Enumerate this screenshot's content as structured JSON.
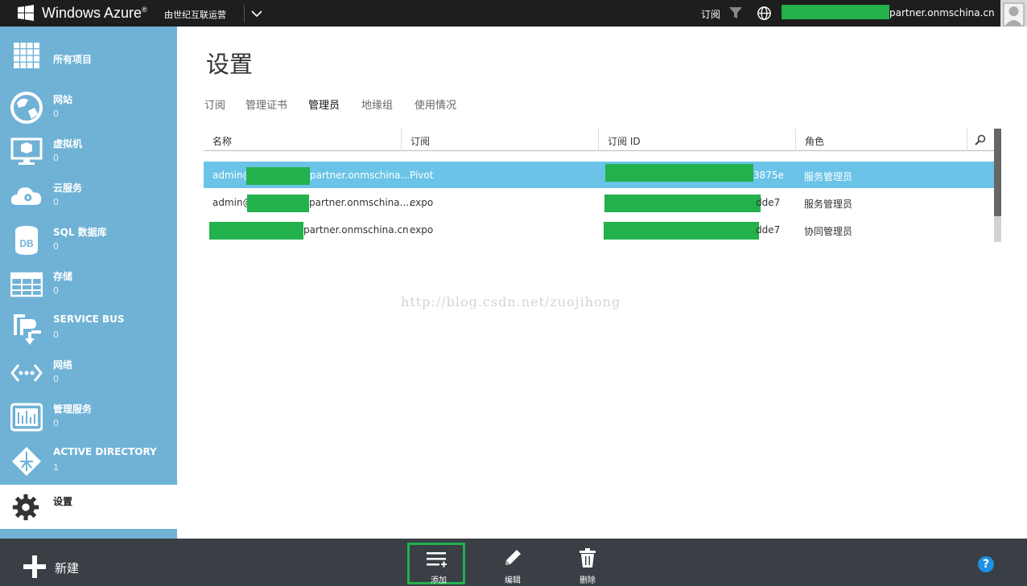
{
  "topbar": {
    "brand": "Windows Azure",
    "brand_mark": "®",
    "operator": "由世纪互联运营",
    "subscriptions_label": "订阅",
    "account_suffix": "partner.onmschina.cn"
  },
  "sidebar": {
    "items": [
      {
        "label": "所有项目",
        "count": "",
        "icon": "grid-icon"
      },
      {
        "label": "网站",
        "count": "0",
        "icon": "website-globe-icon"
      },
      {
        "label": "虚拟机",
        "count": "0",
        "icon": "virtual-machine-icon"
      },
      {
        "label": "云服务",
        "count": "0",
        "icon": "cloud-service-icon"
      },
      {
        "label": "SQL 数据库",
        "count": "0",
        "icon": "database-icon"
      },
      {
        "label": "存储",
        "count": "0",
        "icon": "storage-table-icon"
      },
      {
        "label": "SERVICE BUS",
        "count": "0",
        "icon": "service-bus-icon"
      },
      {
        "label": "网络",
        "count": "0",
        "icon": "network-icon"
      },
      {
        "label": "管理服务",
        "count": "0",
        "icon": "management-services-icon"
      },
      {
        "label": "ACTIVE DIRECTORY",
        "count": "1",
        "icon": "active-directory-icon"
      },
      {
        "label": "设置",
        "count": "",
        "icon": "gear-icon"
      }
    ]
  },
  "main": {
    "title": "设置",
    "tabs": [
      "订阅",
      "管理证书",
      "管理员",
      "地缘组",
      "使用情况"
    ],
    "active_tab": "管理员",
    "columns": [
      "名称",
      "订阅",
      "订阅 ID",
      "角色"
    ],
    "rows": [
      {
        "name_prefix": "admin@",
        "name_suffix": "partner.onmschina....",
        "subscription": "Pivot",
        "id_suffix": "3875e",
        "role": "服务管理员"
      },
      {
        "name_prefix": "admin@",
        "name_suffix": "partner.onmschina....",
        "subscription": "expo",
        "id_suffix": "dde7",
        "role": "服务管理员"
      },
      {
        "name_prefix": "",
        "name_suffix": "partner.onmschina.cn",
        "subscription": "expo",
        "id_suffix": "dde7",
        "role": "协同管理员"
      }
    ]
  },
  "watermark": "http://blog.csdn.net/zuojihong",
  "bottombar": {
    "new_label": "新建",
    "commands": [
      {
        "label": "添加",
        "icon": "add-list-icon"
      },
      {
        "label": "编辑",
        "icon": "pencil-icon"
      },
      {
        "label": "删除",
        "icon": "trash-icon"
      }
    ],
    "help": "?"
  },
  "colors": {
    "sidebar": "#6fb2d6",
    "selected_row": "#6bc4e8",
    "redaction": "#22b14c",
    "bottombar": "#3a3f46",
    "topbar": "#1e1e1e"
  }
}
